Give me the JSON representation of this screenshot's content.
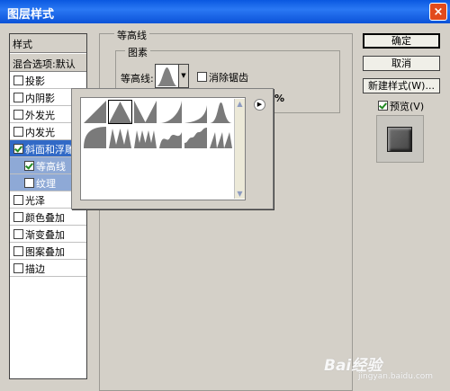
{
  "window": {
    "title": "图层样式",
    "close_glyph": "×"
  },
  "styles_panel": {
    "header": "样式",
    "blending_options": "混合选项:默认",
    "items": [
      {
        "label": "投影",
        "checked": false
      },
      {
        "label": "内阴影",
        "checked": false
      },
      {
        "label": "外发光",
        "checked": false
      },
      {
        "label": "内发光",
        "checked": false
      },
      {
        "label": "斜面和浮雕",
        "checked": true,
        "selected": true
      },
      {
        "label": "等高线",
        "checked": true,
        "sub": true,
        "highlighted": true
      },
      {
        "label": "纹理",
        "checked": false,
        "sub": true,
        "highlighted": true
      },
      {
        "label": "光泽",
        "checked": false
      },
      {
        "label": "颜色叠加",
        "checked": false
      },
      {
        "label": "渐变叠加",
        "checked": false
      },
      {
        "label": "图案叠加",
        "checked": false
      },
      {
        "label": "描边",
        "checked": false
      }
    ]
  },
  "contour_section": {
    "group_title": "等高线",
    "subgroup_title": "图素",
    "contour_label": "等高线:",
    "anti_alias_label": "消除锯齿",
    "anti_alias_checked": false,
    "range_unit": "%"
  },
  "contour_picker": {
    "presets": [
      {
        "name": "linear"
      },
      {
        "name": "cone"
      },
      {
        "name": "cone-inverted"
      },
      {
        "name": "cove-deep"
      },
      {
        "name": "cove-shallow"
      },
      {
        "name": "gaussian"
      },
      {
        "name": "half-round"
      },
      {
        "name": "ring"
      },
      {
        "name": "ring-double"
      },
      {
        "name": "rolling-slope"
      },
      {
        "name": "rounded-steps"
      },
      {
        "name": "sawtooth"
      }
    ],
    "selected_index": 1,
    "menu_glyph": "▶"
  },
  "buttons": {
    "ok": "确定",
    "cancel": "取消",
    "new_style": "新建样式(W)..."
  },
  "preview": {
    "label": "预览(V)",
    "checked": true
  },
  "watermark": {
    "text": "Bai经验",
    "sub": "jingyan.baidu.com"
  }
}
